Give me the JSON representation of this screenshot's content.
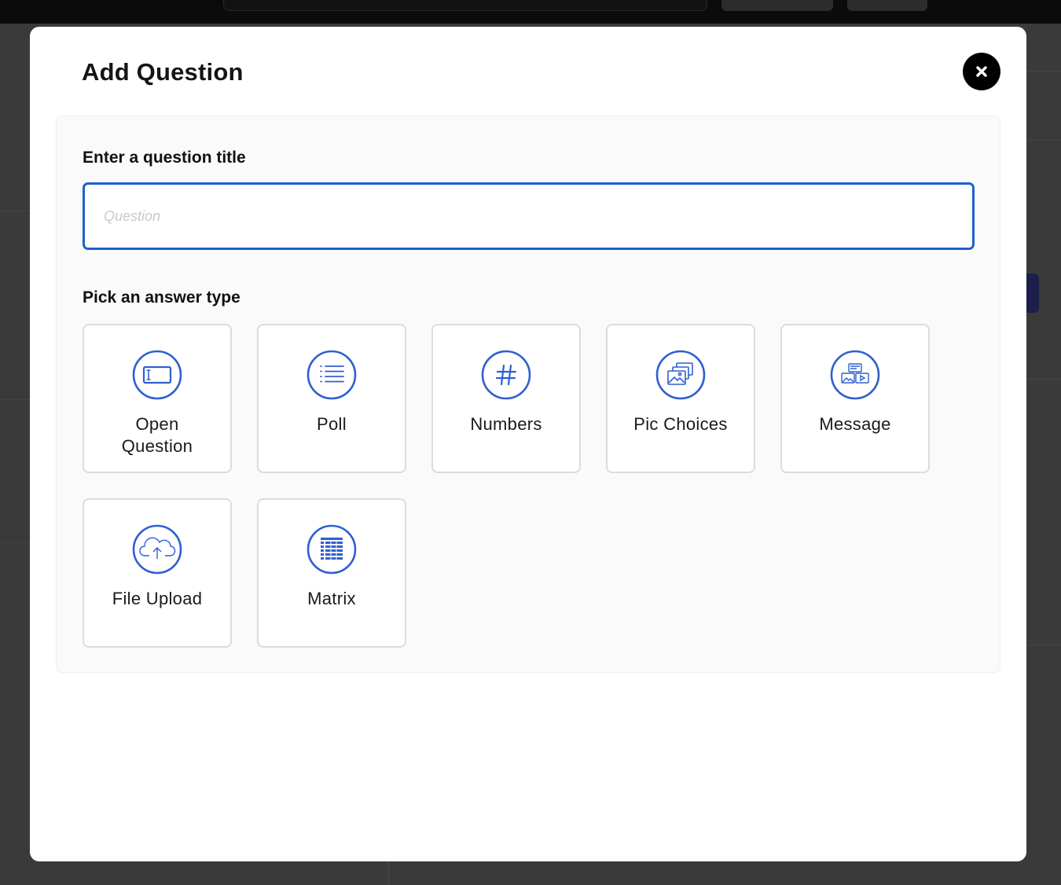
{
  "modal": {
    "title": "Add Question",
    "close_label": "×"
  },
  "question_title": {
    "label": "Enter a question title",
    "value": "",
    "placeholder": "Question"
  },
  "answer_types": {
    "label": "Pick an answer type",
    "items": [
      {
        "label": "Open\nQuestion",
        "icon": "open-question-icon"
      },
      {
        "label": "Poll",
        "icon": "poll-icon"
      },
      {
        "label": "Numbers",
        "icon": "numbers-icon"
      },
      {
        "label": "Pic Choices",
        "icon": "pic-choices-icon"
      },
      {
        "label": "Message",
        "icon": "message-icon"
      },
      {
        "label": "File Upload",
        "icon": "file-upload-icon"
      },
      {
        "label": "Matrix",
        "icon": "matrix-icon"
      }
    ]
  },
  "colors": {
    "accent": "#1f5fd0",
    "icon": "#2f5fd1",
    "close_bg": "#000000"
  }
}
